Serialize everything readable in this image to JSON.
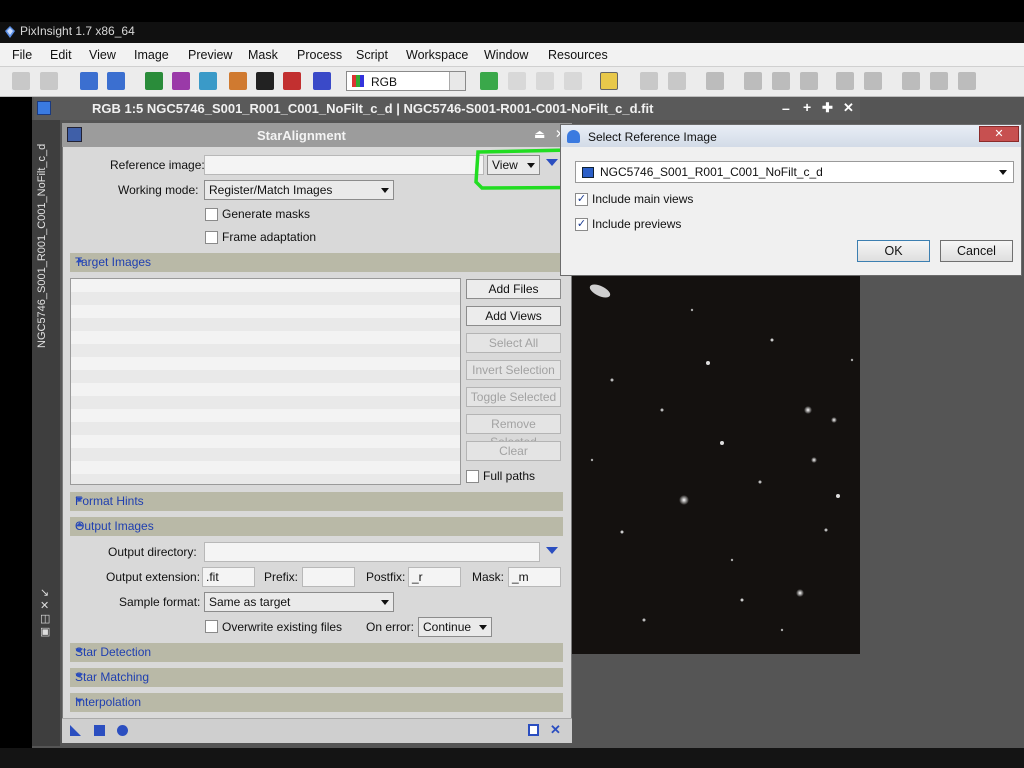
{
  "app": {
    "title": "PixInsight 1.7 x86_64",
    "menus": [
      "File",
      "Edit",
      "View",
      "Image",
      "Preview",
      "Mask",
      "Process",
      "Script",
      "Workspace",
      "Window",
      "Resources"
    ]
  },
  "toolbar": {
    "color_mode": "RGB"
  },
  "image_window": {
    "title": "RGB 1:5 NGC5746_S001_R001_C001_NoFilt_c_d | NGC5746-S001-R001-C001-NoFilt_c_d.fit",
    "side_label": "NGC5746_S001_R001_C001_NoFilt_c_d",
    "controls": [
      "–",
      "+",
      "✕"
    ]
  },
  "panel": {
    "title": "StarAlignment",
    "reference_image_label": "Reference image:",
    "reference_image_value": "",
    "view_button": "View",
    "working_mode_label": "Working mode:",
    "working_mode_value": "Register/Match Images",
    "generate_masks": "Generate masks",
    "frame_adaptation": "Frame adaptation",
    "sections": {
      "target_images": "Target Images",
      "format_hints": "Format Hints",
      "output_images": "Output Images",
      "star_detection": "Star Detection",
      "star_matching": "Star Matching",
      "interpolation": "Interpolation"
    },
    "target_buttons": {
      "add_files": "Add Files",
      "add_views": "Add Views",
      "select_all": "Select All",
      "invert_selection": "Invert Selection",
      "toggle_selected": "Toggle Selected",
      "remove_selected": "Remove Selected",
      "clear": "Clear"
    },
    "full_paths": "Full paths",
    "output_directory_label": "Output directory:",
    "output_directory_value": "",
    "output_extension_label": "Output extension:",
    "output_extension_value": ".fit",
    "prefix_label": "Prefix:",
    "prefix_value": "",
    "postfix_label": "Postfix:",
    "postfix_value": "_r",
    "mask_label": "Mask:",
    "mask_value": "_m",
    "sample_format_label": "Sample format:",
    "sample_format_value": "Same as target",
    "overwrite_label": "Overwrite existing files",
    "on_error_label": "On error:",
    "on_error_value": "Continue"
  },
  "dialog": {
    "title": "Select Reference Image",
    "close": "✕",
    "selected_view": "NGC5746_S001_R001_C001_NoFilt_c_d",
    "include_main_views": "Include main views",
    "include_main_views_checked": true,
    "include_previews": "Include previews",
    "include_previews_checked": true,
    "ok": "OK",
    "cancel": "Cancel"
  },
  "colors": {
    "highlight": "#22dd22",
    "section_text": "#1f3fb0",
    "accent_blue": "#2b4ec0"
  }
}
